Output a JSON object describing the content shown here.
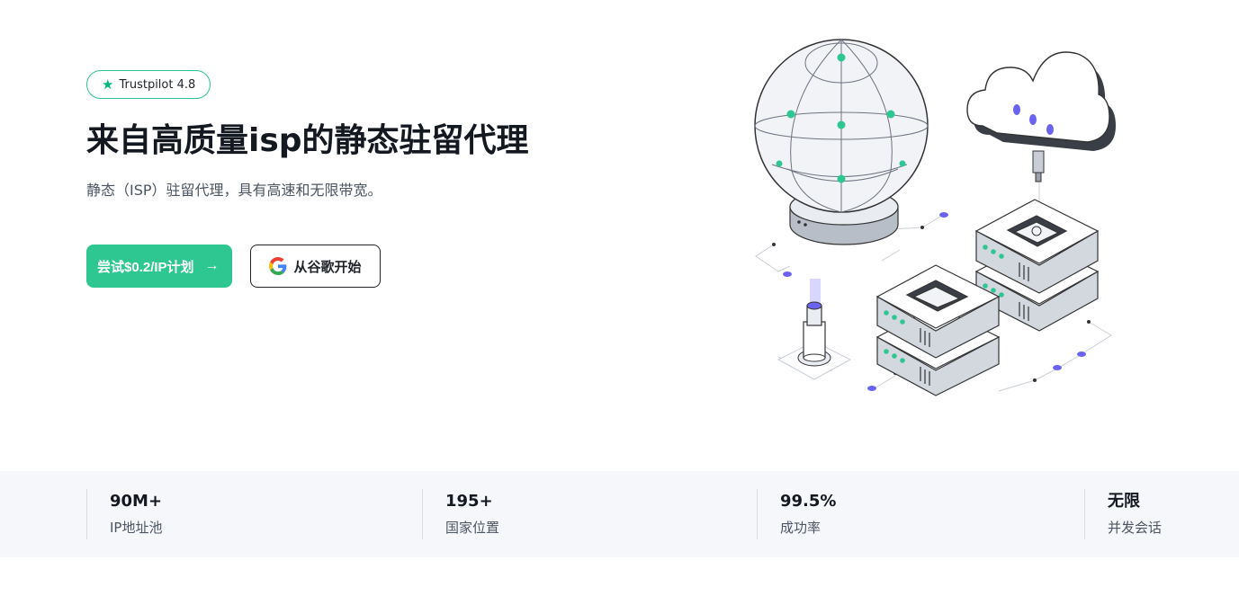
{
  "hero": {
    "badge": {
      "label": "Trustpilot 4.8",
      "icon": "star-icon"
    },
    "title": "来自高质量isp的静态驻留代理",
    "subtitle": "静态（ISP）驻留代理，具有高速和无限带宽。",
    "primary_button": {
      "label": "尝试$0.2/IP计划",
      "icon": "arrow-right-icon"
    },
    "secondary_button": {
      "label": "从谷歌开始",
      "icon": "google-icon"
    }
  },
  "stats": [
    {
      "value": "90M+",
      "label": "IP地址池"
    },
    {
      "value": "195+",
      "label": "国家位置"
    },
    {
      "value": "99.5%",
      "label": "成功率"
    },
    {
      "value": "无限",
      "label": "并发会话"
    }
  ],
  "colors": {
    "accent": "#2ec792",
    "badge_border": "#2ec48d",
    "star": "#00b67a",
    "stats_bg": "#f5f7fa",
    "dot_purple": "#6b63f0"
  }
}
